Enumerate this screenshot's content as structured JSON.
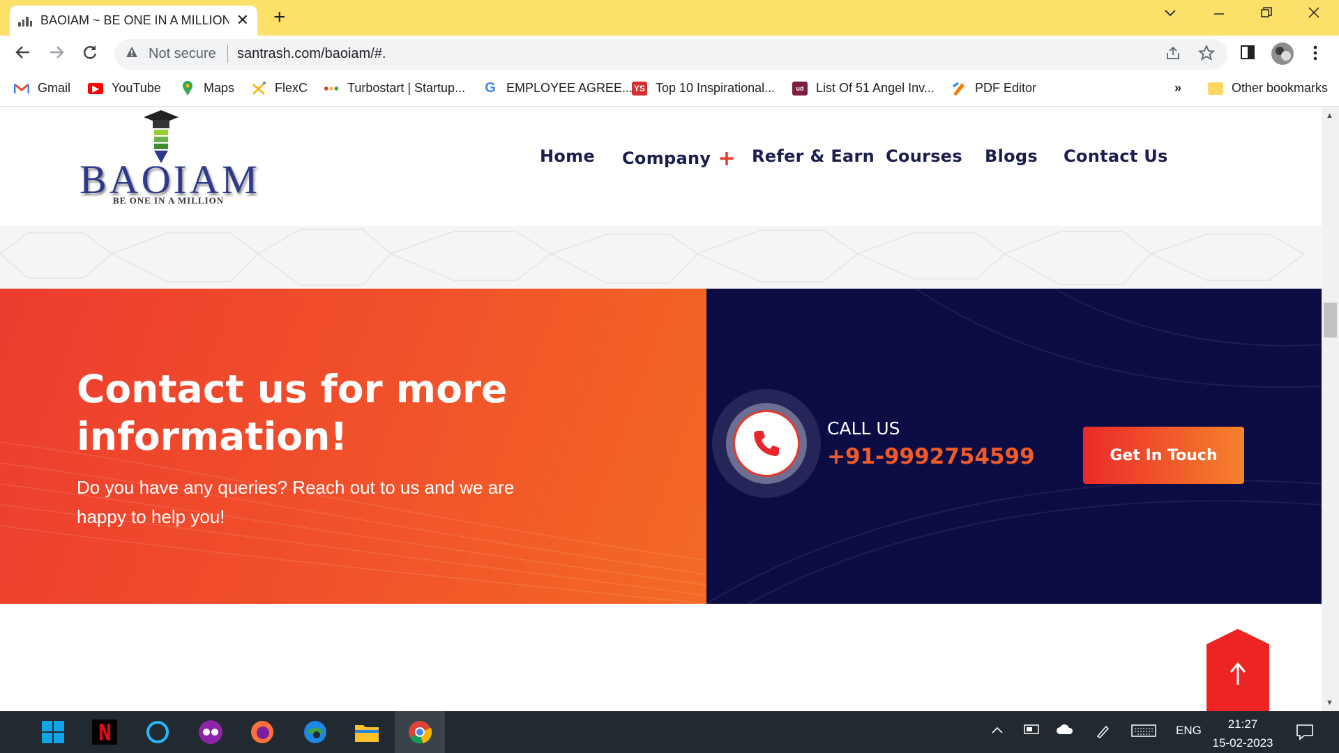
{
  "browser": {
    "tab_title": "BAOIAM ~ BE ONE IN A MILLION",
    "new_tab_symbol": "+",
    "close_symbol": "✕",
    "omnibox": {
      "security_label": "Not secure",
      "url": "santrash.com/baoiam/#."
    },
    "bookmarks": [
      {
        "label": "Gmail",
        "icon": "gmail-icon",
        "color": "#ea4335"
      },
      {
        "label": "YouTube",
        "icon": "youtube-icon",
        "color": "#ff0000"
      },
      {
        "label": "Maps",
        "icon": "maps-icon",
        "color": "#34a853"
      },
      {
        "label": "FlexC",
        "icon": "flexc-icon",
        "color": "#f4b400"
      },
      {
        "label": "Turbostart | Startup...",
        "icon": "turbostart-icon",
        "color": "#e53935"
      },
      {
        "label": "EMPLOYEE AGREE...",
        "icon": "google-icon",
        "color": "#4285f4"
      },
      {
        "label": "Top 10 Inspirational...",
        "icon": "yourstory-icon",
        "color": "#d32f2f"
      },
      {
        "label": "List Of 51 Angel Inv...",
        "icon": "list-icon",
        "color": "#7b1f3a"
      },
      {
        "label": "PDF Editor",
        "icon": "pdf-editor-icon",
        "color": "#f57c00"
      }
    ],
    "overflow_symbol": "»",
    "other_bookmarks": "Other bookmarks"
  },
  "site": {
    "logo": {
      "text": "BAOIAM",
      "tagline": "BE ONE IN A MILLION"
    },
    "nav": [
      "Home",
      "Company",
      "Refer & Earn",
      "Courses",
      "Blogs",
      "Contact Us"
    ],
    "nav_plus": "+",
    "cta": {
      "title": "Contact us for more information!",
      "subtitle": "Do you have any queries? Reach out to us and we are happy to help you!",
      "call_label": "CALL US",
      "phone": "+91-9992754599",
      "button": "Get In Touch"
    },
    "to_top_arrow": "↑"
  },
  "taskbar": {
    "language": "ENG",
    "time": "21:27",
    "date": "15-02-2023"
  },
  "colors": {
    "tab_strip": "#fbe06a",
    "accent_orange": "#f15a29",
    "navy": "#0c0c45",
    "nav_text": "#1a1f4e",
    "to_top_red": "#ee2424"
  }
}
